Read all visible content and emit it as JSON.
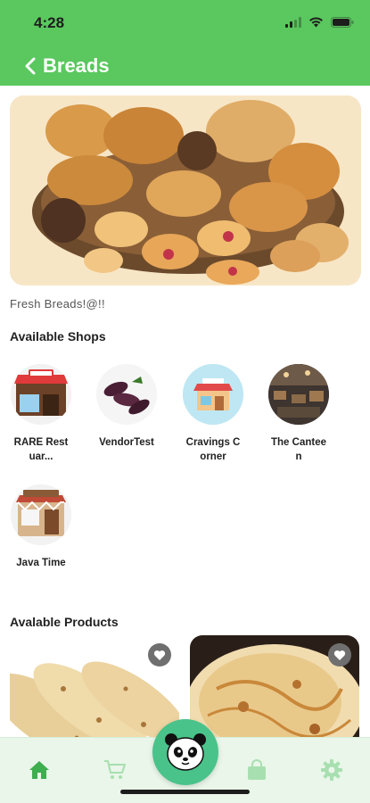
{
  "status_bar": {
    "time": "4:28"
  },
  "header": {
    "title": "Breads"
  },
  "hero": {
    "caption": "Fresh Breads!@!!"
  },
  "shops_section": {
    "title": "Available Shops"
  },
  "shops": [
    {
      "name": "RARE Restuar..."
    },
    {
      "name": "VendorTest"
    },
    {
      "name": "Cravings Corner"
    },
    {
      "name": "The Canteen"
    },
    {
      "name": "Java Time"
    }
  ],
  "products_section": {
    "title": "Avalable Products"
  },
  "colors": {
    "brand": "#5ac85e",
    "fab": "#49c38a",
    "tab_bar": "#e9f6e9"
  }
}
